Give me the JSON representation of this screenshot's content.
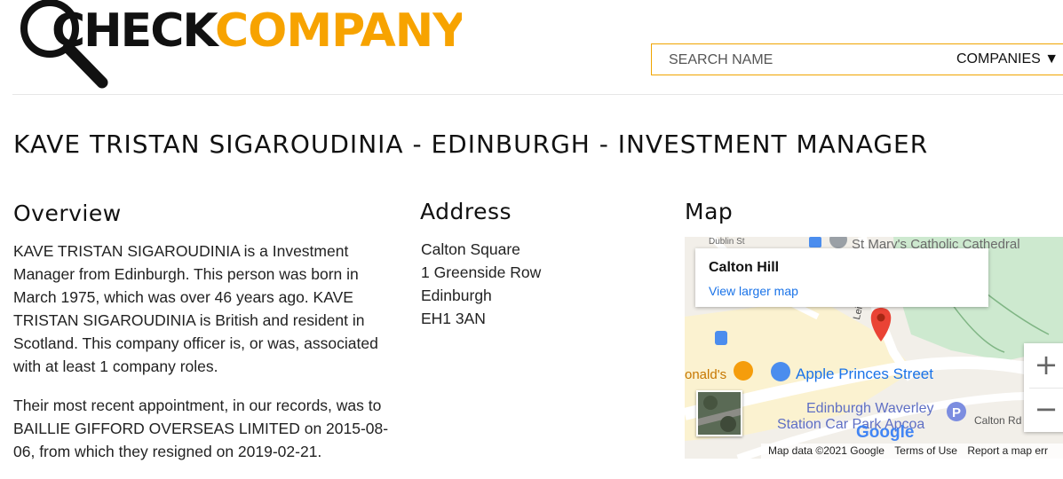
{
  "brand": {
    "part1": "CHECK",
    "part2": "COMPANY",
    "dark_color": "#111111",
    "accent_color": "#f7a300"
  },
  "search": {
    "placeholder": "SEARCH NAME",
    "type_label": "COMPANIES ▼"
  },
  "page_title": "KAVE TRISTAN SIGAROUDINIA - EDINBURGH - INVESTMENT MANAGER",
  "overview": {
    "heading": "Overview",
    "paragraphs": [
      "KAVE TRISTAN SIGAROUDINIA is a Investment Manager from Edinburgh. This person was born in March 1975, which was over 46 years ago. KAVE TRISTAN SIGAROUDINIA is British and resident in Scotland. This company officer is, or was, associated with at least 1 company roles.",
      "Their most recent appointment, in our records, was to BAILLIE GIFFORD OVERSEAS LIMITED on 2015-08-06, from which they resigned on 2019-02-21."
    ]
  },
  "address": {
    "heading": "Address",
    "lines": [
      "Calton Square",
      "1 Greenside Row",
      "Edinburgh",
      "EH1 3AN"
    ]
  },
  "map": {
    "heading": "Map",
    "place_name": "Calton Hill",
    "larger_link": "View larger map",
    "zoom_in": "+",
    "zoom_out": "−",
    "labels": {
      "dublin": "Dublin St",
      "cathedral": "St Mary's Catholic Cathedral",
      "leith": "Leith St",
      "apple": "Apple Princes Street",
      "mcdonalds": "onald's",
      "waverley1": "Edinburgh Waverley",
      "waverley2": "Station Car Park Apcoa",
      "calton_rd": "Calton Rd",
      "google": "Google"
    },
    "attribution": {
      "data": "Map data ©2021 Google",
      "terms": "Terms of Use",
      "report": "Report a map err"
    }
  }
}
